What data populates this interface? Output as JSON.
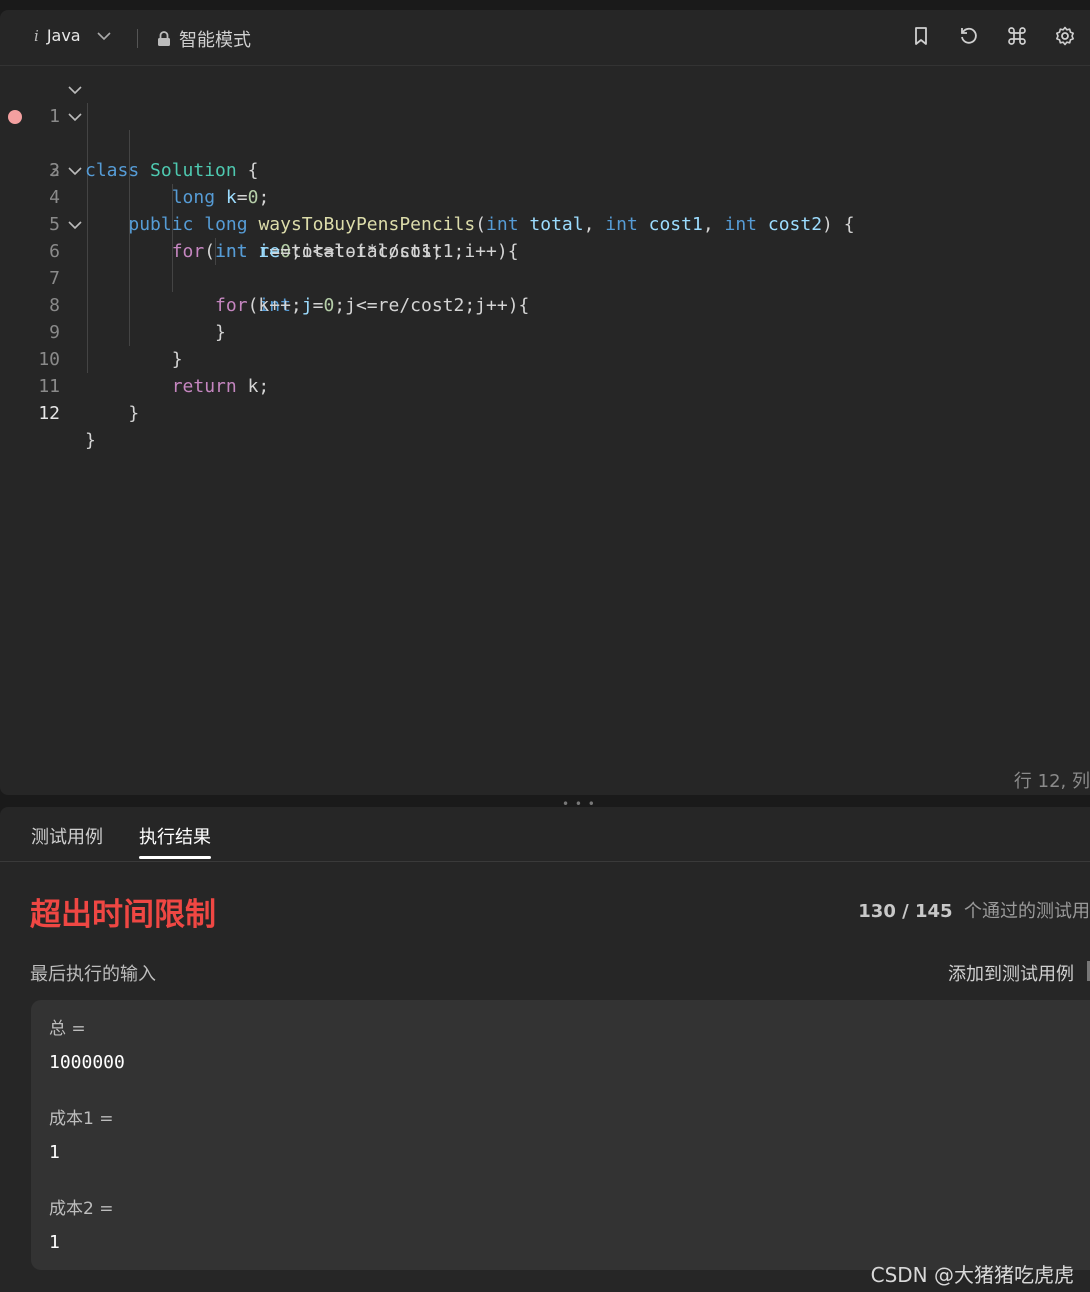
{
  "toolbar": {
    "language": "Java",
    "mode": "智能模式",
    "icons": [
      "bookmark-icon",
      "reset-icon",
      "command-icon",
      "settings-icon"
    ]
  },
  "code_lines": [
    {
      "n": "1"
    },
    {
      "n": "2"
    },
    {
      "n": "3"
    },
    {
      "n": "4"
    },
    {
      "n": "5"
    },
    {
      "n": "6"
    },
    {
      "n": "7"
    },
    {
      "n": "8"
    },
    {
      "n": "9"
    },
    {
      "n": "10"
    },
    {
      "n": "11"
    },
    {
      "n": "12"
    }
  ],
  "code": {
    "l1": [
      "class",
      "Solution",
      "{"
    ],
    "l2": [
      "public",
      "long",
      "waysToBuyPensPencils",
      "(",
      "int",
      "total",
      ", ",
      "int",
      "cost1",
      ", ",
      "int",
      "cost2",
      ") {"
    ],
    "l3": [
      "long",
      "k",
      "=",
      "0",
      ";"
    ],
    "l4": [
      "for",
      "(",
      "int",
      "i",
      "=",
      "0",
      ";i<=total/cost1;i++){"
    ],
    "l5": [
      "int",
      "re",
      "=total-i*cost1;"
    ],
    "l6": [
      "for",
      "(",
      "int",
      "j",
      "=",
      "0",
      ";j<=re/cost2;j++){"
    ],
    "l7": [
      "k++;"
    ],
    "l8": [
      "}"
    ],
    "l9": [
      "}"
    ],
    "l10": [
      "return",
      "k;"
    ],
    "l11": [
      "}"
    ],
    "l12": [
      "}"
    ]
  },
  "status": "行 12, 列",
  "tabs": {
    "test_cases": "测试用例",
    "results": "执行结果"
  },
  "result": {
    "title": "超出时间限制",
    "passed": "130 / 145",
    "passed_suffix": "个通过的测试用",
    "last_input_label": "最后执行的输入",
    "add_to_cases": "添加到测试用例"
  },
  "inputs": [
    {
      "name": "总 =",
      "value": "1000000"
    },
    {
      "name": "成本1 =",
      "value": "1"
    },
    {
      "name": "成本2 =",
      "value": "1"
    }
  ],
  "watermark": "CSDN @大猪猪吃虎虎"
}
